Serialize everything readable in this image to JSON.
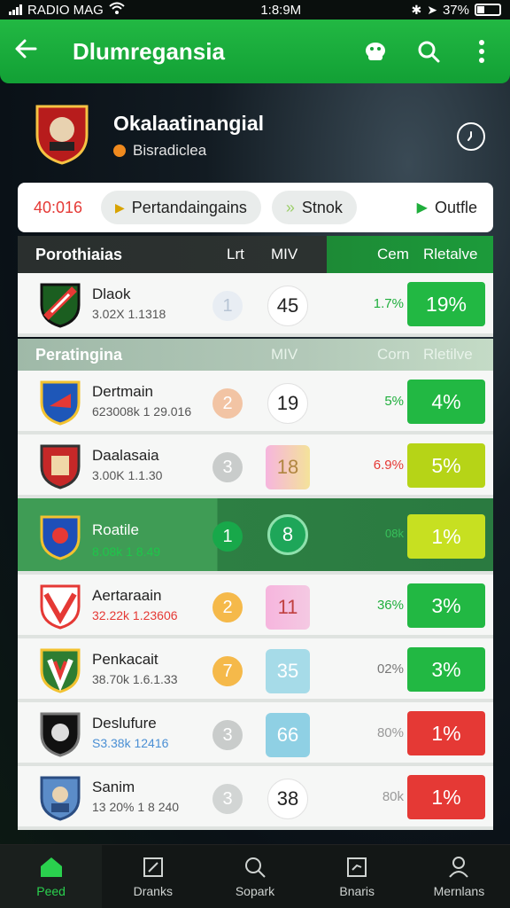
{
  "status": {
    "carrier": "RADIO MAG",
    "time": "1:8:9M",
    "battery": "37%"
  },
  "app_bar": {
    "title": "Dlumregansia"
  },
  "team": {
    "name": "Okalaatinangial",
    "subtitle": "Bisradiclea"
  },
  "filters": {
    "time": "40:016",
    "chip1": "Pertandaingains",
    "chip2": "Stnok",
    "outfit": "Outfle"
  },
  "table": {
    "header1": {
      "title": "Porothiaias",
      "c1": "Lrt",
      "c2": "MIV",
      "c3": "Cem",
      "c4": "Rletalve"
    },
    "header2": {
      "title": "Peratingina",
      "c2": "MIV",
      "c3": "Corn",
      "c4": "Rletilve"
    },
    "first_row": {
      "name": "Dlaok",
      "sub": "3.02X 1.1318",
      "rank": "1",
      "value": "45",
      "trend": "1.7%",
      "pct": "19%"
    },
    "rows": [
      {
        "name": "Dertmain",
        "sub": "623008k 1 29.016",
        "rank": "2",
        "value": "19",
        "trend": "5%",
        "pct": "4%"
      },
      {
        "name": "Daalasaia",
        "sub": "3.00K 1.1.30",
        "rank": "3",
        "value": "18",
        "trend": "6.9%",
        "pct": "5%"
      },
      {
        "name": "Roatile",
        "sub": "8.08k 1 8.49",
        "rank": "1",
        "value": "8",
        "trend": "08k",
        "pct": "1%"
      },
      {
        "name": "Aertaraain",
        "sub": "32.22k 1.23606",
        "rank": "2",
        "value": "11",
        "trend": "36%",
        "pct": "3%"
      },
      {
        "name": "Penkacait",
        "sub": "38.70k 1.6.1.33",
        "rank": "7",
        "value": "35",
        "trend": "02%",
        "pct": "3%"
      },
      {
        "name": "Deslufure",
        "sub": "S3.38k 12416",
        "rank": "3",
        "value": "66",
        "trend": "80%",
        "pct": "1%"
      },
      {
        "name": "Sanim",
        "sub": "13 20% 1 8 240",
        "rank": "3",
        "value": "38",
        "trend": "80k",
        "pct": "1%"
      }
    ]
  },
  "nav": {
    "home": "Peed",
    "b2": "Dranks",
    "b3": "Sopark",
    "b4": "Bnaris",
    "b5": "Mernlans"
  },
  "colors": {
    "brand_green": "#1fae3c",
    "red": "#e53935",
    "lime": "#b6d417"
  }
}
